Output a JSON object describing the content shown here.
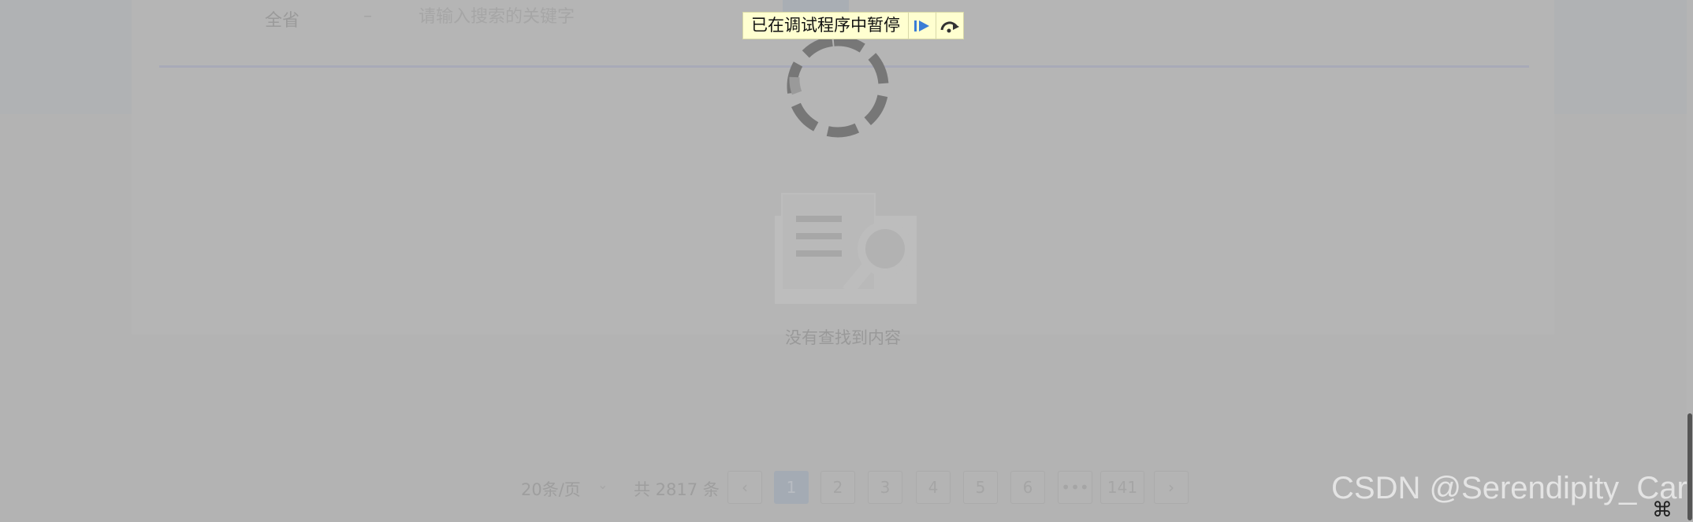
{
  "filter": {
    "region_label": "全省",
    "separator": "–",
    "search_placeholder": "请输入搜索的关键字"
  },
  "debugger": {
    "message": "已在调试程序中暂停",
    "resume_icon": "play-resume-icon",
    "step_over_icon": "step-over-icon",
    "background_color": "#ffffd0"
  },
  "empty_state": {
    "message": "没有查找到内容",
    "icon": "document-search-icon"
  },
  "pagination": {
    "page_size_label": "20条/页",
    "page_size_arrow": "⌄",
    "total_label": "共 2817 条",
    "prev_symbol": "‹",
    "pages": [
      "1",
      "2",
      "3",
      "4",
      "5",
      "6"
    ],
    "ellipsis": "•••",
    "last_page": "141",
    "next_symbol": "›",
    "current_page": "1"
  },
  "watermark": "CSDN @Serendipity_Carl",
  "corner_icon": "⌘",
  "colors": {
    "overlay": "#b3b3b3",
    "active_page": "#a4abb4"
  }
}
